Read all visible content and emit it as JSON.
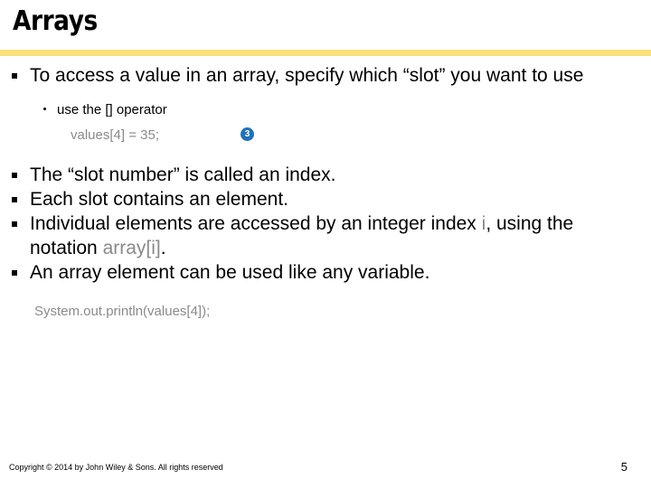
{
  "slide": {
    "title": "Arrays",
    "accent_color": "#f8e07a",
    "bullets": [
      {
        "level": 1,
        "text": "To access a value in an array, specify which “slot” you want to use"
      }
    ],
    "sub_bullet": {
      "level": 2,
      "text": "use the [] operator"
    },
    "code_example": "values[4] = 35;",
    "badge": {
      "label": "3",
      "color": "#1f72b8"
    },
    "bullets_rest": [
      {
        "level": 1,
        "text": "The “slot number” is called an index."
      },
      {
        "level": 1,
        "text": "Each slot contains an element."
      }
    ],
    "bullet_index": {
      "part1": "Individual elements are accessed by an integer index ",
      "code1": "i",
      "part2": ", using the notation ",
      "code2": "array[i]",
      "part3": "."
    },
    "bullet_variable": {
      "level": 1,
      "text": "An array element can be used like any variable."
    },
    "code_println": "System.out.println(values[4]);"
  },
  "footer": {
    "copyright": "Copyright © 2014 by John Wiley & Sons.  All rights reserved",
    "page_number": "5"
  }
}
